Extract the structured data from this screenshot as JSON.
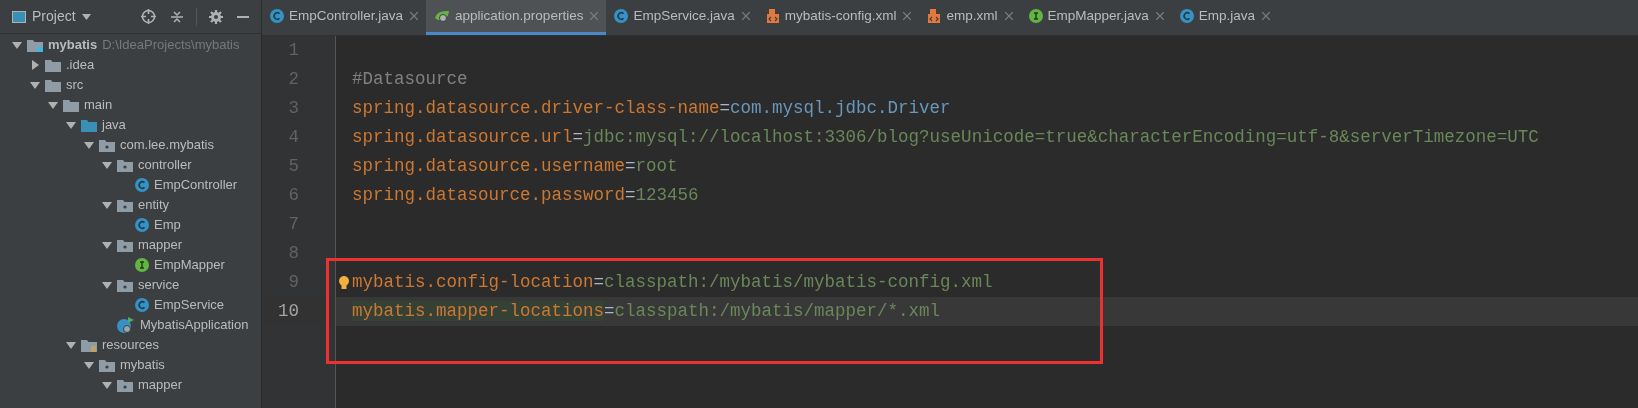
{
  "project_panel": {
    "title": "Project",
    "tree": [
      {
        "kind": "module",
        "label": "mybatis",
        "path": "D:\\IdeaProjects\\mybatis",
        "expanded": true,
        "children": [
          {
            "kind": "folder",
            "label": ".idea",
            "expanded": false
          },
          {
            "kind": "folder",
            "label": "src",
            "expanded": true,
            "children": [
              {
                "kind": "folder",
                "label": "main",
                "expanded": true,
                "children": [
                  {
                    "kind": "source",
                    "label": "java",
                    "expanded": true,
                    "children": [
                      {
                        "kind": "package",
                        "label": "com.lee.mybatis",
                        "expanded": true,
                        "children": [
                          {
                            "kind": "package",
                            "label": "controller",
                            "expanded": true,
                            "children": [
                              {
                                "kind": "class",
                                "label": "EmpController"
                              }
                            ]
                          },
                          {
                            "kind": "package",
                            "label": "entity",
                            "expanded": true,
                            "children": [
                              {
                                "kind": "class",
                                "label": "Emp"
                              }
                            ]
                          },
                          {
                            "kind": "package",
                            "label": "mapper",
                            "expanded": true,
                            "children": [
                              {
                                "kind": "interface",
                                "label": "EmpMapper"
                              }
                            ]
                          },
                          {
                            "kind": "package",
                            "label": "service",
                            "expanded": true,
                            "children": [
                              {
                                "kind": "class",
                                "label": "EmpService"
                              }
                            ]
                          },
                          {
                            "kind": "app",
                            "label": "MybatisApplication"
                          }
                        ]
                      }
                    ]
                  },
                  {
                    "kind": "resources",
                    "label": "resources",
                    "expanded": true,
                    "children": [
                      {
                        "kind": "package",
                        "label": "mybatis",
                        "expanded": true,
                        "children": [
                          {
                            "kind": "package",
                            "label": "mapper",
                            "expanded": true
                          }
                        ]
                      }
                    ]
                  }
                ]
              }
            ]
          }
        ]
      }
    ]
  },
  "tabs": [
    {
      "kind": "class",
      "label": "EmpController.java",
      "selected": false
    },
    {
      "kind": "properties",
      "label": "application.properties",
      "selected": true
    },
    {
      "kind": "class",
      "label": "EmpService.java",
      "selected": false
    },
    {
      "kind": "xml",
      "label": "mybatis-config.xml",
      "selected": false
    },
    {
      "kind": "xml",
      "label": "emp.xml",
      "selected": false
    },
    {
      "kind": "interface",
      "label": "EmpMapper.java",
      "selected": false
    },
    {
      "kind": "class",
      "label": "Emp.java",
      "selected": false
    }
  ],
  "editor": {
    "lines": [
      {
        "number": "1",
        "current": false
      },
      {
        "number": "2",
        "current": false,
        "tokens": [
          {
            "kind": "comment",
            "text": "#Datasource"
          }
        ]
      },
      {
        "number": "3",
        "current": false,
        "tokens": [
          {
            "kind": "key",
            "text": "spring.datasource.driver-class-name"
          },
          {
            "kind": "operator",
            "text": "="
          },
          {
            "kind": "class",
            "text": "com.mysql.jdbc.Driver"
          }
        ]
      },
      {
        "number": "4",
        "current": false,
        "tokens": [
          {
            "kind": "key",
            "text": "spring.datasource.url"
          },
          {
            "kind": "operator",
            "text": "="
          },
          {
            "kind": "string",
            "text": "jdbc:mysql://localhost:3306/blog?useUnicode=true&characterEncoding=utf-8&serverTimezone=UTC"
          }
        ]
      },
      {
        "number": "5",
        "current": false,
        "tokens": [
          {
            "kind": "key",
            "text": "spring.datasource.username"
          },
          {
            "kind": "operator",
            "text": "="
          },
          {
            "kind": "string",
            "text": "root"
          }
        ]
      },
      {
        "number": "6",
        "current": false,
        "tokens": [
          {
            "kind": "key",
            "text": "spring.datasource.password"
          },
          {
            "kind": "operator",
            "text": "="
          },
          {
            "kind": "string",
            "text": "123456"
          }
        ]
      },
      {
        "number": "7",
        "current": false
      },
      {
        "number": "8",
        "current": false
      },
      {
        "number": "9",
        "current": false,
        "bulb": true,
        "tokens": [
          {
            "kind": "key",
            "text": "mybatis.config-location"
          },
          {
            "kind": "operator",
            "text": "="
          },
          {
            "kind": "string",
            "text": "classpath:/mybatis/mybatis-config.xml"
          }
        ]
      },
      {
        "number": "10",
        "current": true,
        "tokens": [
          {
            "kind": "matched_key",
            "text": "mybatis.mapper-locations"
          },
          {
            "kind": "operator",
            "text": "="
          },
          {
            "kind": "string",
            "text": "classpath:/mybatis/mapper/*.xml"
          }
        ]
      }
    ]
  }
}
